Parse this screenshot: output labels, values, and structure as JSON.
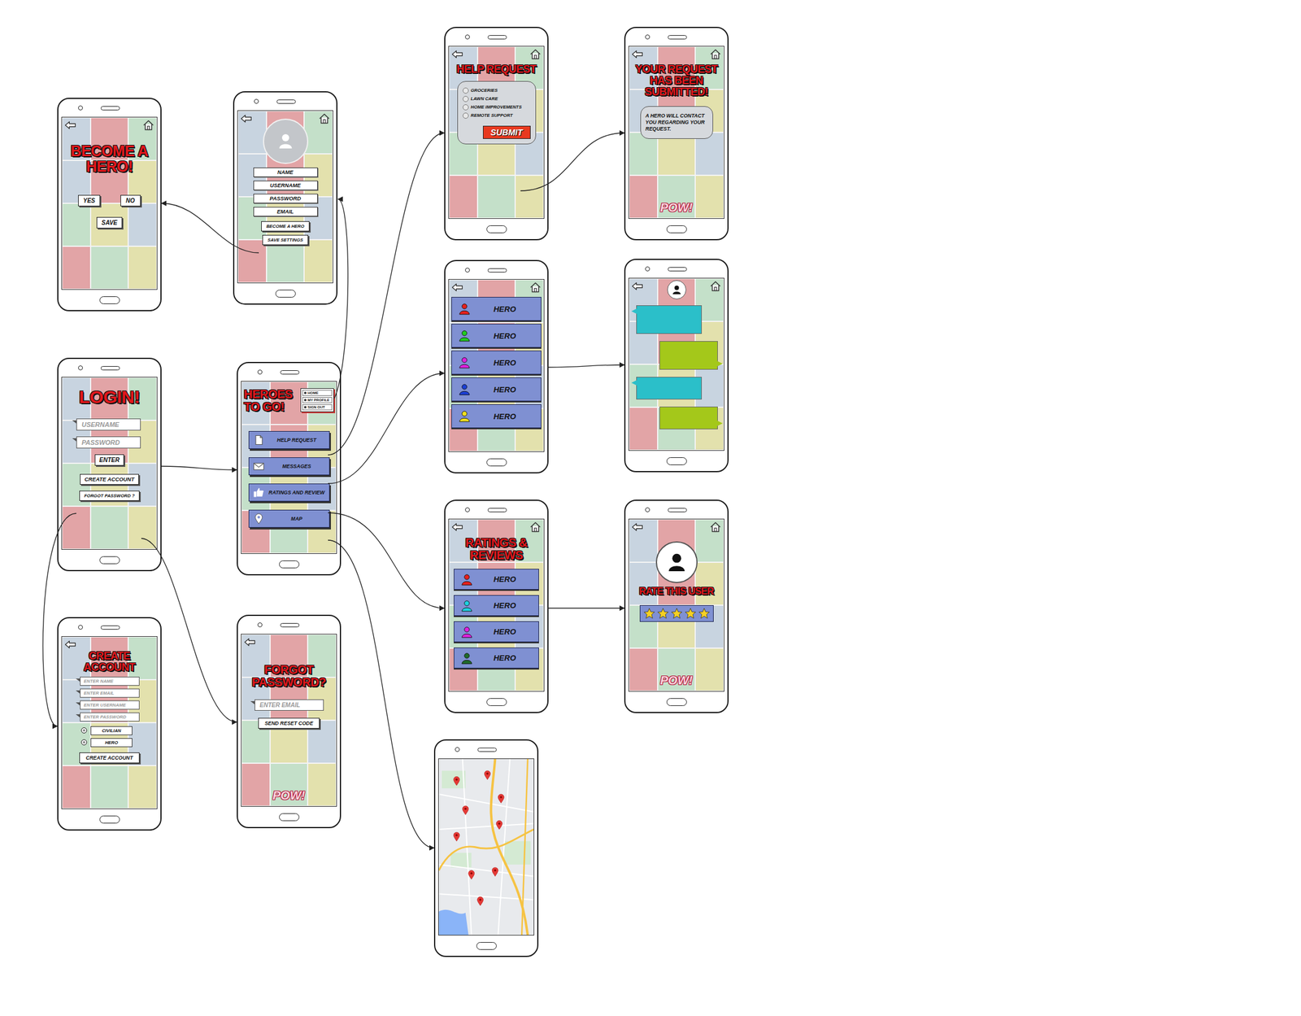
{
  "screens": {
    "become-hero": {
      "back": true,
      "home": true,
      "title": "BECOME A HERO!",
      "choices": [
        {
          "label": "YES",
          "selected": false
        },
        {
          "label": "NO",
          "selected": false
        }
      ],
      "save": "SAVE"
    },
    "profile": {
      "back": true,
      "home": true,
      "fields": [
        "NAME",
        "USERNAME",
        "PASSWORD",
        "EMAIL"
      ],
      "buttons": [
        "BECOME A HERO",
        "SAVE SETTINGS"
      ]
    },
    "help": {
      "back": true,
      "home": true,
      "title": "HELP REQUEST",
      "options": [
        {
          "label": "GROCERIES",
          "selected": false
        },
        {
          "label": "LAWN CARE",
          "selected": false
        },
        {
          "label": "HOME IMPROVEMENTS",
          "selected": false
        },
        {
          "label": "REMOTE SUPPORT",
          "selected": false
        }
      ],
      "submit": "SUBMIT"
    },
    "submitted": {
      "back": true,
      "home": true,
      "title": "YOUR REQUEST HAS BEEN SUBMITTED!",
      "message": "A HERO WILL CONTACT YOU REGARDING YOUR REQUEST.",
      "decor": [
        "POW!"
      ]
    },
    "heroes": {
      "back": true,
      "home": true,
      "heroes": [
        {
          "name": "HERO",
          "color": "#e8201c"
        },
        {
          "name": "HERO",
          "color": "#22cc22"
        },
        {
          "name": "HERO",
          "color": "#e020e0"
        },
        {
          "name": "HERO",
          "color": "#1a3fd6"
        },
        {
          "name": "HERO",
          "color": "#f0e020"
        }
      ]
    },
    "chat": {
      "back": true,
      "home": true,
      "messages": [
        {
          "kind": "received"
        },
        {
          "kind": "sent"
        },
        {
          "kind": "received"
        },
        {
          "kind": "sent"
        }
      ]
    },
    "login": {
      "back": false,
      "home": false,
      "title": "LOGIN!",
      "fields": [
        {
          "placeholder": "USERNAME"
        },
        {
          "placeholder": "PASSWORD"
        }
      ],
      "enter": "ENTER",
      "create": "CREATE ACCOUNT",
      "forgot": "FORGOT PASSWORD ?"
    },
    "main": {
      "back": false,
      "home": false,
      "title": "HEROES TO GO!",
      "menu": [
        "HOME",
        "MY PROFILE",
        "SIGN OUT"
      ],
      "buttons": [
        {
          "label": "HELP REQUEST",
          "kind": "request"
        },
        {
          "label": "MESSAGES",
          "kind": "messages"
        },
        {
          "label": "RATINGS AND REVIEW",
          "kind": "ratings"
        },
        {
          "label": "MAP",
          "kind": "map"
        }
      ]
    },
    "ratings": {
      "back": true,
      "home": true,
      "title": "RATINGS & REVIEWS",
      "heroes": [
        {
          "name": "HERO",
          "color": "#e8201c"
        },
        {
          "name": "HERO",
          "color": "#1ed2e0"
        },
        {
          "name": "HERO",
          "color": "#e020e0"
        },
        {
          "name": "HERO",
          "color": "#1f6b2a"
        }
      ]
    },
    "rate": {
      "back": true,
      "home": true,
      "title": "RATE THIS USER",
      "stars": 5,
      "decor": [
        "POW!"
      ]
    },
    "create": {
      "back": true,
      "home": false,
      "title": "CREATE ACCOUNT",
      "fields": [
        {
          "placeholder": "ENTER NAME"
        },
        {
          "placeholder": "ENTER EMAIL"
        },
        {
          "placeholder": "ENTER USERNAME"
        },
        {
          "placeholder": "ENTER PASSWORD"
        }
      ],
      "roles": [
        {
          "label": "CIVILIAN",
          "selected": false
        },
        {
          "label": "HERO",
          "selected": false
        }
      ],
      "submit": "CREATE ACCOUNT"
    },
    "forgot": {
      "back": true,
      "home": false,
      "title": "FORGOT PASSWORD?",
      "field": {
        "placeholder": "ENTER EMAIL"
      },
      "submit": "SEND RESET CODE",
      "decor": [
        "POW!"
      ]
    },
    "map": {
      "back": false,
      "home": false
    }
  }
}
